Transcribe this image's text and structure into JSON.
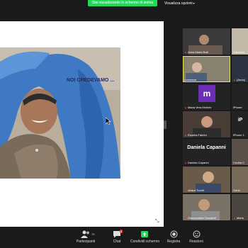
{
  "topbar": {
    "share_banner": "Stai visualizzando lo schermo di anima",
    "view_options": "Visualizza opzioni"
  },
  "slide": {
    "title": "NOI CREDEVAMO ..."
  },
  "gallery": {
    "tiles": [
      {
        "name": "Anna Maria Bulli"
      },
      {
        "name": "Gabriella"
      },
      {
        "name": "Loredana"
      },
      {
        "name": "(Anna)"
      },
      {
        "name": "Maria Vera Morichi",
        "initial": "m"
      },
      {
        "name": "iPhone"
      },
      {
        "name": "Rosella Fabrini"
      },
      {
        "name": "iPhone 1",
        "label": "iP"
      },
      {
        "name": "Daniela Capanni",
        "label": "Daniela Capanni"
      },
      {
        "name": "Cecilia C"
      },
      {
        "name": "chiara Turchi"
      },
      {
        "name": "Gerfo"
      },
      {
        "name": "Giancamarla Toccaceli"
      },
      {
        "name": "Mario"
      }
    ]
  },
  "toolbar": {
    "participants_label": "Partecipanti",
    "participants_count": "75",
    "chat_label": "Chat",
    "chat_badge": "6",
    "share_label": "Condividi schermo",
    "record_label": "Registra",
    "reactions_label": "Reazioni"
  },
  "colors": {
    "banner": "#23d959",
    "share_icon": "#23d959",
    "active_speaker": "#e7e35b",
    "avatar_purple": "#6b2fb5"
  }
}
